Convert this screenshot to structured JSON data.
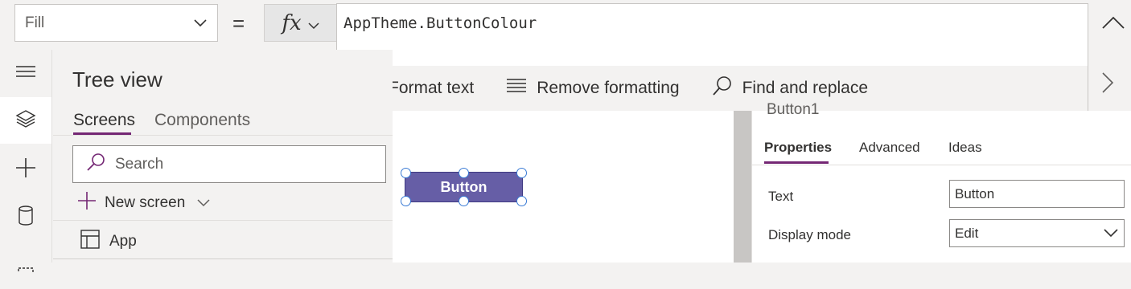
{
  "formula_bar": {
    "property": "Fill",
    "equals": "=",
    "fx_label": "fx",
    "formula": "AppTheme.ButtonColour",
    "tools": [
      {
        "label": "Format text",
        "icon": "format-text-icon"
      },
      {
        "label": "Remove formatting",
        "icon": "remove-formatting-icon"
      },
      {
        "label": "Find and replace",
        "icon": "find-replace-icon"
      }
    ]
  },
  "left_rail": {
    "items": [
      "hamburger-menu-icon",
      "tree-view-layers-icon",
      "insert-plus-icon",
      "data-cylinder-icon",
      "media-icon"
    ],
    "active": "tree-view-layers-icon"
  },
  "tree_view": {
    "title": "Tree view",
    "tabs": [
      "Screens",
      "Components"
    ],
    "active_tab": "Screens",
    "search_placeholder": "Search",
    "new_screen_label": "New screen",
    "items": [
      {
        "label": "App",
        "icon": "app-icon"
      }
    ]
  },
  "canvas": {
    "button_text": "Button"
  },
  "properties_panel": {
    "control_name": "Button1",
    "tabs": [
      "Properties",
      "Advanced",
      "Ideas"
    ],
    "active_tab": "Properties",
    "rows": [
      {
        "label": "Text",
        "value": "Button"
      },
      {
        "label": "Display mode",
        "value": "Edit"
      }
    ]
  },
  "colors": {
    "accent": "#742774",
    "button_fill": "#665ea6",
    "selection_handle": "#3a7bd5"
  }
}
